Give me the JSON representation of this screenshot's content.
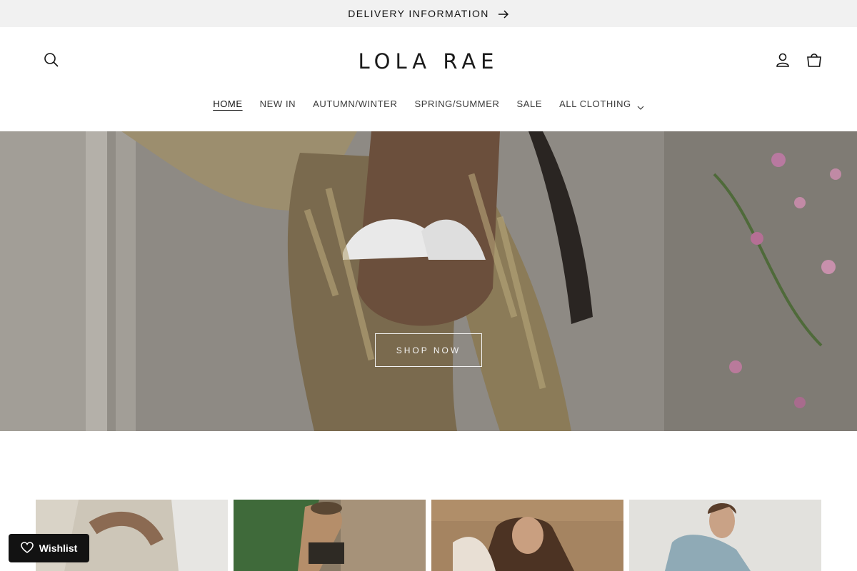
{
  "announcement": {
    "text": "DELIVERY INFORMATION",
    "icon": "arrow-right-icon"
  },
  "header": {
    "logo": "LOLA RAE",
    "icons": {
      "search": "search-icon",
      "account": "user-icon",
      "cart": "cart-icon"
    }
  },
  "nav": {
    "items": [
      {
        "label": "HOME",
        "active": true
      },
      {
        "label": "NEW IN"
      },
      {
        "label": "AUTUMN/WINTER"
      },
      {
        "label": "SPRING/SUMMER"
      },
      {
        "label": "SALE"
      },
      {
        "label": "ALL CLOTHING",
        "has_dropdown": true
      }
    ]
  },
  "hero": {
    "button_label": "SHOP NOW"
  },
  "wishlist": {
    "label": "Wishlist",
    "icon": "heart-icon"
  },
  "colors": {
    "announcement_bg": "#f1f1f1",
    "text": "#121212",
    "wishlist_bg": "#121212"
  }
}
